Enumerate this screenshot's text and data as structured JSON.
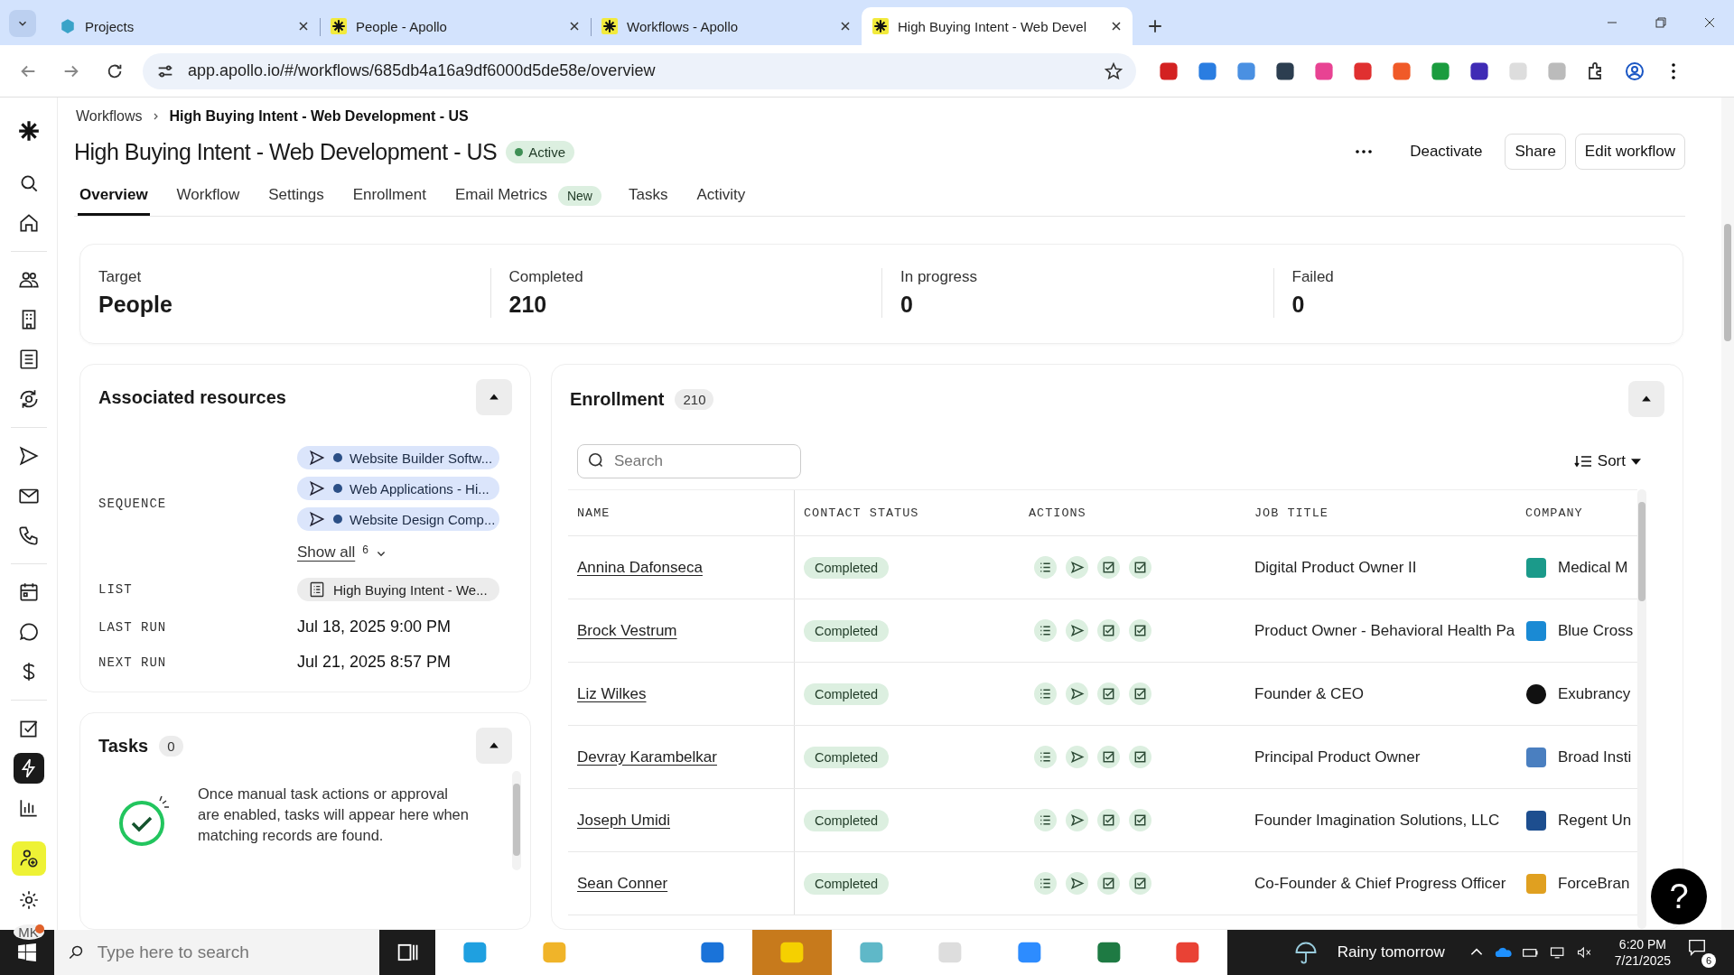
{
  "browser": {
    "tabs": [
      {
        "title": "Projects",
        "selected": false
      },
      {
        "title": "People - Apollo",
        "selected": false
      },
      {
        "title": "Workflows - Apollo",
        "selected": false
      },
      {
        "title": "High Buying Intent - Web Devel",
        "selected": true
      }
    ],
    "url": "app.apollo.io/#/workflows/685db4a16a9df6000d5de58e/overview"
  },
  "sidebar": {
    "items": [
      {
        "selected": false
      },
      {
        "selected": false
      },
      {
        "selected": false
      },
      {
        "selected": false
      },
      {
        "selected": false
      },
      {
        "selected": false
      },
      {
        "selected": false
      },
      {
        "selected": false
      },
      {
        "selected": false
      },
      {
        "selected": false
      },
      {
        "selected": false
      },
      {
        "selected": false
      },
      {
        "selected": true
      },
      {
        "selected": false
      }
    ],
    "avatar": "MK"
  },
  "breadcrumb": [
    "Workflows",
    "High Buying Intent - Web Development - US"
  ],
  "title": "High Buying Intent - Web Development - US",
  "status": "Active",
  "actions": [
    "Deactivate",
    "Share",
    "Edit workflow"
  ],
  "tabs": [
    {
      "label": "Overview",
      "selected": true
    },
    {
      "label": "Workflow",
      "selected": false
    },
    {
      "label": "Settings",
      "selected": false
    },
    {
      "label": "Enrollment",
      "selected": false
    },
    {
      "label": "Email Metrics",
      "badge": "New",
      "selected": false
    },
    {
      "label": "Tasks",
      "selected": false
    },
    {
      "label": "Activity",
      "selected": false
    }
  ],
  "stats": [
    {
      "label": "Target",
      "value": "People"
    },
    {
      "label": "Completed",
      "value": "210"
    },
    {
      "label": "In progress",
      "value": "0"
    },
    {
      "label": "Failed",
      "value": "0"
    }
  ],
  "resources": {
    "title": "Associated resources",
    "sequence_label": "SEQUENCE",
    "sequences": [
      "Website Builder Softw...",
      "Web Applications - Hi...",
      "Website Design Comp..."
    ],
    "show_all": "Show all",
    "show_all_count": "6",
    "list_label": "LIST",
    "list": "High Buying Intent - We...",
    "last_run_label": "LAST RUN",
    "last_run": "Jul 18, 2025 9:00 PM",
    "next_run_label": "NEXT RUN",
    "next_run": "Jul 21, 2025 8:57 PM"
  },
  "tasks": {
    "title": "Tasks",
    "count": "0",
    "message": "Once manual task actions or approval are enabled, tasks will appear here when matching records are found."
  },
  "enrollment": {
    "title": "Enrollment",
    "count": "210",
    "search_placeholder": "Search",
    "sort": "Sort",
    "columns": [
      "NAME",
      "CONTACT STATUS",
      "ACTIONS",
      "JOB TITLE",
      "COMPANY"
    ],
    "rows": [
      {
        "name": "Annina Dafonseca",
        "status": "Completed",
        "job": "Digital Product Owner II",
        "company": "Medical M"
      },
      {
        "name": "Brock Vestrum",
        "status": "Completed",
        "job": "Product Owner - Behavioral Health Pa",
        "company": "Blue Cross"
      },
      {
        "name": "Liz Wilkes",
        "status": "Completed",
        "job": "Founder & CEO",
        "company": "Exubrancy"
      },
      {
        "name": "Devray Karambelkar",
        "status": "Completed",
        "job": "Principal Product Owner",
        "company": "Broad Insti"
      },
      {
        "name": "Joseph Umidi",
        "status": "Completed",
        "job": "Founder Imagination Solutions, LLC",
        "company": "Regent Un"
      },
      {
        "name": "Sean Conner",
        "status": "Completed",
        "job": "Co-Founder & Chief Progress Officer",
        "company": "ForceBran"
      }
    ]
  },
  "help": "?",
  "taskbar": {
    "search_placeholder": "Type here to search",
    "weather": "Rainy tomorrow",
    "time": "6:20 PM",
    "date": "7/21/2025",
    "notifications": "6"
  }
}
